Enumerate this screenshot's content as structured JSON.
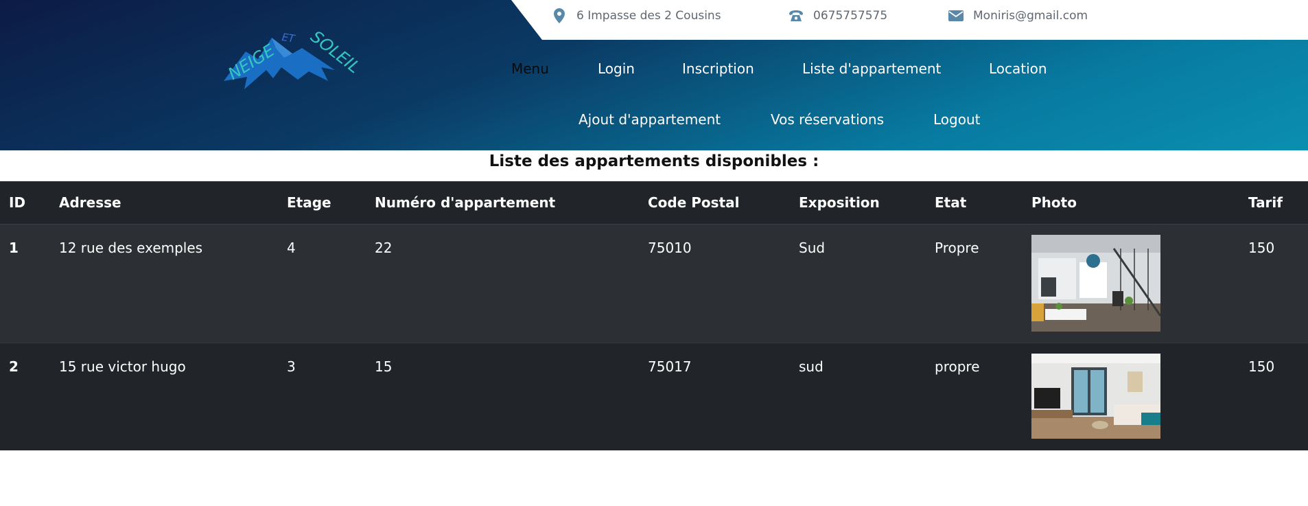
{
  "brand": {
    "logo_text": "NEIGE ET SOLEIL",
    "logo_text_color": "#34c7c1",
    "mountain_color": "#1a6fc4"
  },
  "contact": {
    "address": "6 Impasse des 2 Cousins",
    "phone": "0675757575",
    "email": "Moniris@gmail.com",
    "icon_color": "#5a88a8"
  },
  "nav": {
    "menu": "Menu",
    "login": "Login",
    "inscription": "Inscription",
    "liste": "Liste d'appartement",
    "location": "Location",
    "ajout": "Ajout d'appartement",
    "reservations": "Vos réservations",
    "logout": "Logout"
  },
  "page": {
    "heading": "Liste des appartements disponibles :"
  },
  "table": {
    "columns": [
      "ID",
      "Adresse",
      "Etage",
      "Numéro d'appartement",
      "Code Postal",
      "Exposition",
      "Etat",
      "Photo",
      "Tarif"
    ],
    "rows": [
      {
        "id": "1",
        "adresse": "12 rue des exemples",
        "etage": "4",
        "numero": "22",
        "code_postal": "75010",
        "exposition": "Sud",
        "etat": "Propre",
        "photo": "apartment-photo",
        "tarif": "150"
      },
      {
        "id": "2",
        "adresse": "15 rue victor hugo",
        "etage": "3",
        "numero": "15",
        "code_postal": "75017",
        "exposition": "sud",
        "etat": "propre",
        "photo": "apartment-photo",
        "tarif": "150"
      }
    ]
  },
  "colors": {
    "header_start": "#0c1b45",
    "header_end": "#0a8fb0",
    "table_bg": "#212529",
    "table_row_alt": "#2c3034"
  }
}
